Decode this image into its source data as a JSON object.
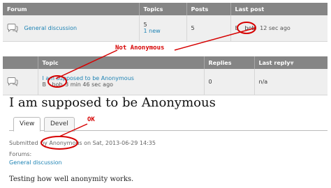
{
  "forum_table": {
    "headers": [
      "Forum",
      "Topics",
      "Posts",
      "Last post"
    ],
    "row": {
      "forum": "General discussion",
      "topics": "5",
      "topics_new": "1 new",
      "posts": "5",
      "last_post_by_prefix": "B",
      "last_post_user": "bob",
      "last_post_time": "12 sec ago"
    }
  },
  "topic_table": {
    "headers": [
      "",
      "Topic",
      "Replies",
      "Last reply"
    ],
    "row": {
      "title": "I am supposed to be Anonymous",
      "by_prefix": "B",
      "user": "bob",
      "time": "3 min 46 sec ago",
      "replies": "0",
      "last_reply": "n/a"
    }
  },
  "node": {
    "title": "I am supposed to be Anonymous",
    "tabs": [
      "View",
      "Devel"
    ],
    "submitted_prefix": "Submitted",
    "submitted_by": "by Anonymous",
    "submitted_on": "on Sat, 2013-06-29 14:35",
    "forums_label": "Forums:",
    "forum_link": "General discussion",
    "body": "Testing how well anonymity works."
  },
  "annotations": {
    "not_anonymous": "Not Anonymous",
    "ok": "OK",
    "color": "#d60000"
  },
  "colors": {
    "header_bg": "#858585",
    "row_bg": "#efefef",
    "link": "#1e83b4"
  },
  "icons": [
    "forum-speech-bubble-icon",
    "topic-speech-bubble-icon",
    "sort-arrow-down-icon"
  ]
}
